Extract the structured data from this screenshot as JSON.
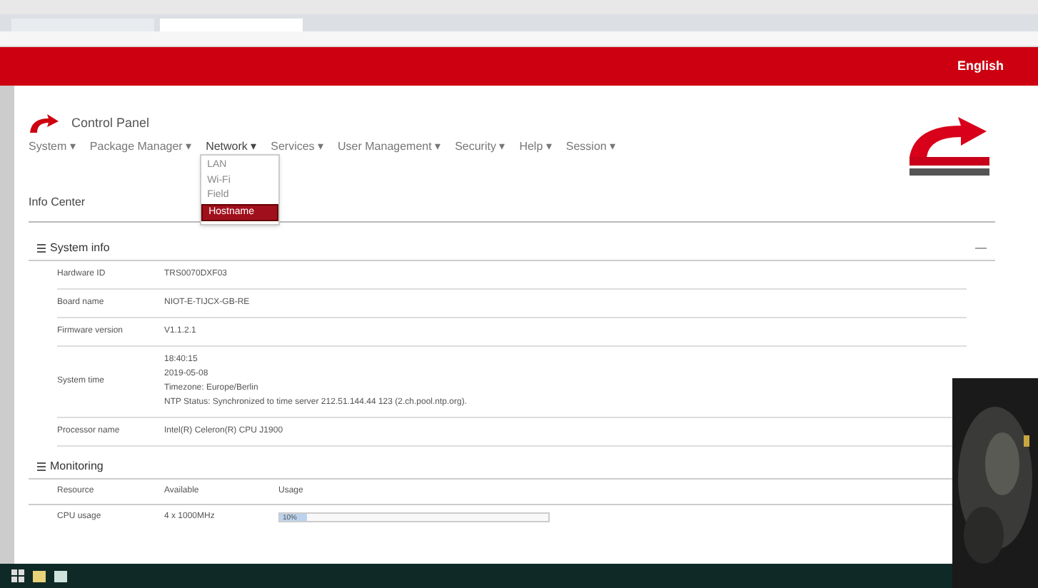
{
  "header": {
    "language": "English"
  },
  "brand": {
    "title": "Control Panel"
  },
  "menu": [
    {
      "label": "System ▾",
      "expanded": false
    },
    {
      "label": "Package Manager ▾",
      "expanded": false
    },
    {
      "label": "Network ▾",
      "expanded": true
    },
    {
      "label": "Services ▾",
      "expanded": false
    },
    {
      "label": "User Management ▾",
      "expanded": false
    },
    {
      "label": "Security ▾",
      "expanded": false
    },
    {
      "label": "Help ▾",
      "expanded": false
    },
    {
      "label": "Session ▾",
      "expanded": false
    }
  ],
  "dropdown": [
    {
      "label": "LAN",
      "selected": false
    },
    {
      "label": "Wi-Fi",
      "selected": false
    },
    {
      "label": "Field",
      "selected": false
    },
    {
      "label": "Hostname",
      "selected": true
    }
  ],
  "page_title": "Info Center",
  "system_info": {
    "title": "System info",
    "collapse": "—",
    "rows": [
      {
        "label": "Hardware ID",
        "values": [
          "TRS0070DXF03"
        ]
      },
      {
        "label": "Board name",
        "values": [
          "NIOT-E-TIJCX-GB-RE"
        ]
      },
      {
        "label": "Firmware version",
        "values": [
          "V1.1.2.1"
        ]
      },
      {
        "label": "System time",
        "values": [
          "18:40:15",
          "2019-05-08",
          "Timezone: Europe/Berlin",
          "NTP Status: Synchronized to time server 212.51.144.44 123 (2.ch.pool.ntp.org)."
        ]
      },
      {
        "label": "Processor name",
        "values": [
          "Intel(R) Celeron(R) CPU J1900"
        ]
      }
    ]
  },
  "monitoring": {
    "title": "Monitoring",
    "columns": [
      "Resource",
      "Available",
      "Usage"
    ],
    "rows": [
      {
        "resource": "CPU usage",
        "available": "4 x 1000MHz",
        "usage": "10%",
        "level": 0.1
      }
    ]
  }
}
